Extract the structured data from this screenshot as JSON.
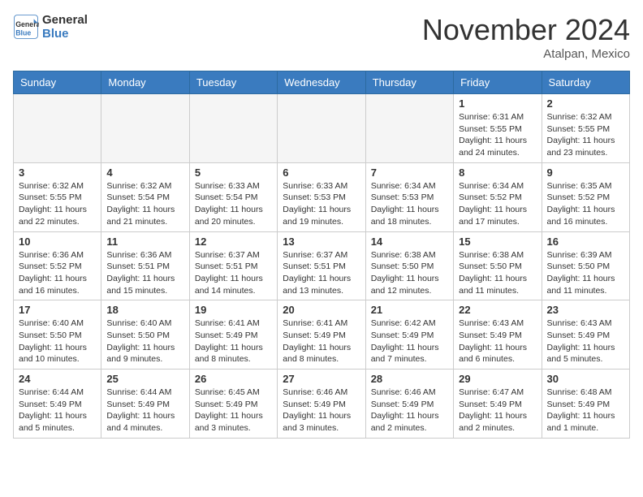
{
  "header": {
    "logo_line1": "General",
    "logo_line2": "Blue",
    "month": "November 2024",
    "location": "Atalpan, Mexico"
  },
  "weekdays": [
    "Sunday",
    "Monday",
    "Tuesday",
    "Wednesday",
    "Thursday",
    "Friday",
    "Saturday"
  ],
  "weeks": [
    [
      {
        "day": "",
        "info": ""
      },
      {
        "day": "",
        "info": ""
      },
      {
        "day": "",
        "info": ""
      },
      {
        "day": "",
        "info": ""
      },
      {
        "day": "",
        "info": ""
      },
      {
        "day": "1",
        "info": "Sunrise: 6:31 AM\nSunset: 5:55 PM\nDaylight: 11 hours and 24 minutes."
      },
      {
        "day": "2",
        "info": "Sunrise: 6:32 AM\nSunset: 5:55 PM\nDaylight: 11 hours and 23 minutes."
      }
    ],
    [
      {
        "day": "3",
        "info": "Sunrise: 6:32 AM\nSunset: 5:55 PM\nDaylight: 11 hours and 22 minutes."
      },
      {
        "day": "4",
        "info": "Sunrise: 6:32 AM\nSunset: 5:54 PM\nDaylight: 11 hours and 21 minutes."
      },
      {
        "day": "5",
        "info": "Sunrise: 6:33 AM\nSunset: 5:54 PM\nDaylight: 11 hours and 20 minutes."
      },
      {
        "day": "6",
        "info": "Sunrise: 6:33 AM\nSunset: 5:53 PM\nDaylight: 11 hours and 19 minutes."
      },
      {
        "day": "7",
        "info": "Sunrise: 6:34 AM\nSunset: 5:53 PM\nDaylight: 11 hours and 18 minutes."
      },
      {
        "day": "8",
        "info": "Sunrise: 6:34 AM\nSunset: 5:52 PM\nDaylight: 11 hours and 17 minutes."
      },
      {
        "day": "9",
        "info": "Sunrise: 6:35 AM\nSunset: 5:52 PM\nDaylight: 11 hours and 16 minutes."
      }
    ],
    [
      {
        "day": "10",
        "info": "Sunrise: 6:36 AM\nSunset: 5:52 PM\nDaylight: 11 hours and 16 minutes."
      },
      {
        "day": "11",
        "info": "Sunrise: 6:36 AM\nSunset: 5:51 PM\nDaylight: 11 hours and 15 minutes."
      },
      {
        "day": "12",
        "info": "Sunrise: 6:37 AM\nSunset: 5:51 PM\nDaylight: 11 hours and 14 minutes."
      },
      {
        "day": "13",
        "info": "Sunrise: 6:37 AM\nSunset: 5:51 PM\nDaylight: 11 hours and 13 minutes."
      },
      {
        "day": "14",
        "info": "Sunrise: 6:38 AM\nSunset: 5:50 PM\nDaylight: 11 hours and 12 minutes."
      },
      {
        "day": "15",
        "info": "Sunrise: 6:38 AM\nSunset: 5:50 PM\nDaylight: 11 hours and 11 minutes."
      },
      {
        "day": "16",
        "info": "Sunrise: 6:39 AM\nSunset: 5:50 PM\nDaylight: 11 hours and 11 minutes."
      }
    ],
    [
      {
        "day": "17",
        "info": "Sunrise: 6:40 AM\nSunset: 5:50 PM\nDaylight: 11 hours and 10 minutes."
      },
      {
        "day": "18",
        "info": "Sunrise: 6:40 AM\nSunset: 5:50 PM\nDaylight: 11 hours and 9 minutes."
      },
      {
        "day": "19",
        "info": "Sunrise: 6:41 AM\nSunset: 5:49 PM\nDaylight: 11 hours and 8 minutes."
      },
      {
        "day": "20",
        "info": "Sunrise: 6:41 AM\nSunset: 5:49 PM\nDaylight: 11 hours and 8 minutes."
      },
      {
        "day": "21",
        "info": "Sunrise: 6:42 AM\nSunset: 5:49 PM\nDaylight: 11 hours and 7 minutes."
      },
      {
        "day": "22",
        "info": "Sunrise: 6:43 AM\nSunset: 5:49 PM\nDaylight: 11 hours and 6 minutes."
      },
      {
        "day": "23",
        "info": "Sunrise: 6:43 AM\nSunset: 5:49 PM\nDaylight: 11 hours and 5 minutes."
      }
    ],
    [
      {
        "day": "24",
        "info": "Sunrise: 6:44 AM\nSunset: 5:49 PM\nDaylight: 11 hours and 5 minutes."
      },
      {
        "day": "25",
        "info": "Sunrise: 6:44 AM\nSunset: 5:49 PM\nDaylight: 11 hours and 4 minutes."
      },
      {
        "day": "26",
        "info": "Sunrise: 6:45 AM\nSunset: 5:49 PM\nDaylight: 11 hours and 3 minutes."
      },
      {
        "day": "27",
        "info": "Sunrise: 6:46 AM\nSunset: 5:49 PM\nDaylight: 11 hours and 3 minutes."
      },
      {
        "day": "28",
        "info": "Sunrise: 6:46 AM\nSunset: 5:49 PM\nDaylight: 11 hours and 2 minutes."
      },
      {
        "day": "29",
        "info": "Sunrise: 6:47 AM\nSunset: 5:49 PM\nDaylight: 11 hours and 2 minutes."
      },
      {
        "day": "30",
        "info": "Sunrise: 6:48 AM\nSunset: 5:49 PM\nDaylight: 11 hours and 1 minute."
      }
    ]
  ]
}
